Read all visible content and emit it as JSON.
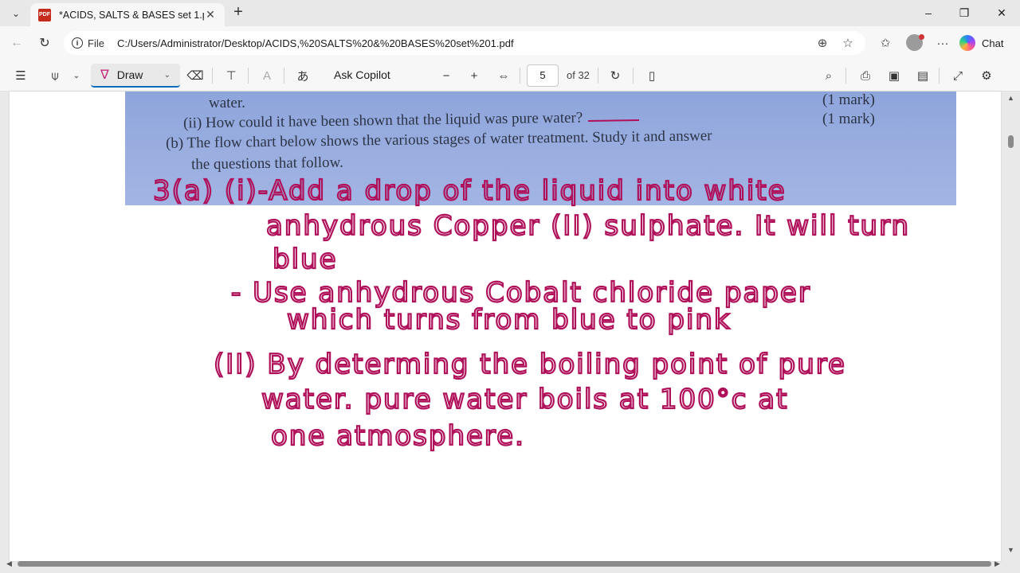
{
  "tab": {
    "title": "*ACIDS, SALTS & BASES set 1.pdf",
    "icon": "pdf-icon"
  },
  "address": {
    "label": "File",
    "url": "C:/Users/Administrator/Desktop/ACIDS,%20SALTS%20&%20BASES%20set%201.pdf"
  },
  "browser": {
    "chat_label": "Chat"
  },
  "pdf_toolbar": {
    "draw_label": "Draw",
    "ask_copilot_label": "Ask Copilot",
    "page_number": "5",
    "page_total": "of 32",
    "translate_glyph": "あ"
  },
  "document": {
    "printed": {
      "line1": "water.",
      "line1_mark": "(1 mark)",
      "line2": "(ii) How could it have been shown that the liquid was pure water?",
      "line2_mark": "(1 mark)",
      "line3": "(b) The flow chart below shows the various stages of water treatment. Study it and answer",
      "line4": "the questions that follow."
    },
    "handwritten": [
      "3(a) (i)-Add a drop of the liquid into white",
      "anhydrous Copper (II) sulphate. It will turn",
      "blue",
      "- Use anhydrous Cobalt chloride paper",
      "which turns from blue to pink",
      "(II) By determing the boiling point of pure",
      "water. pure water boils at 100°c at",
      "one atmosphere."
    ],
    "ink_color": "#b0105a"
  }
}
